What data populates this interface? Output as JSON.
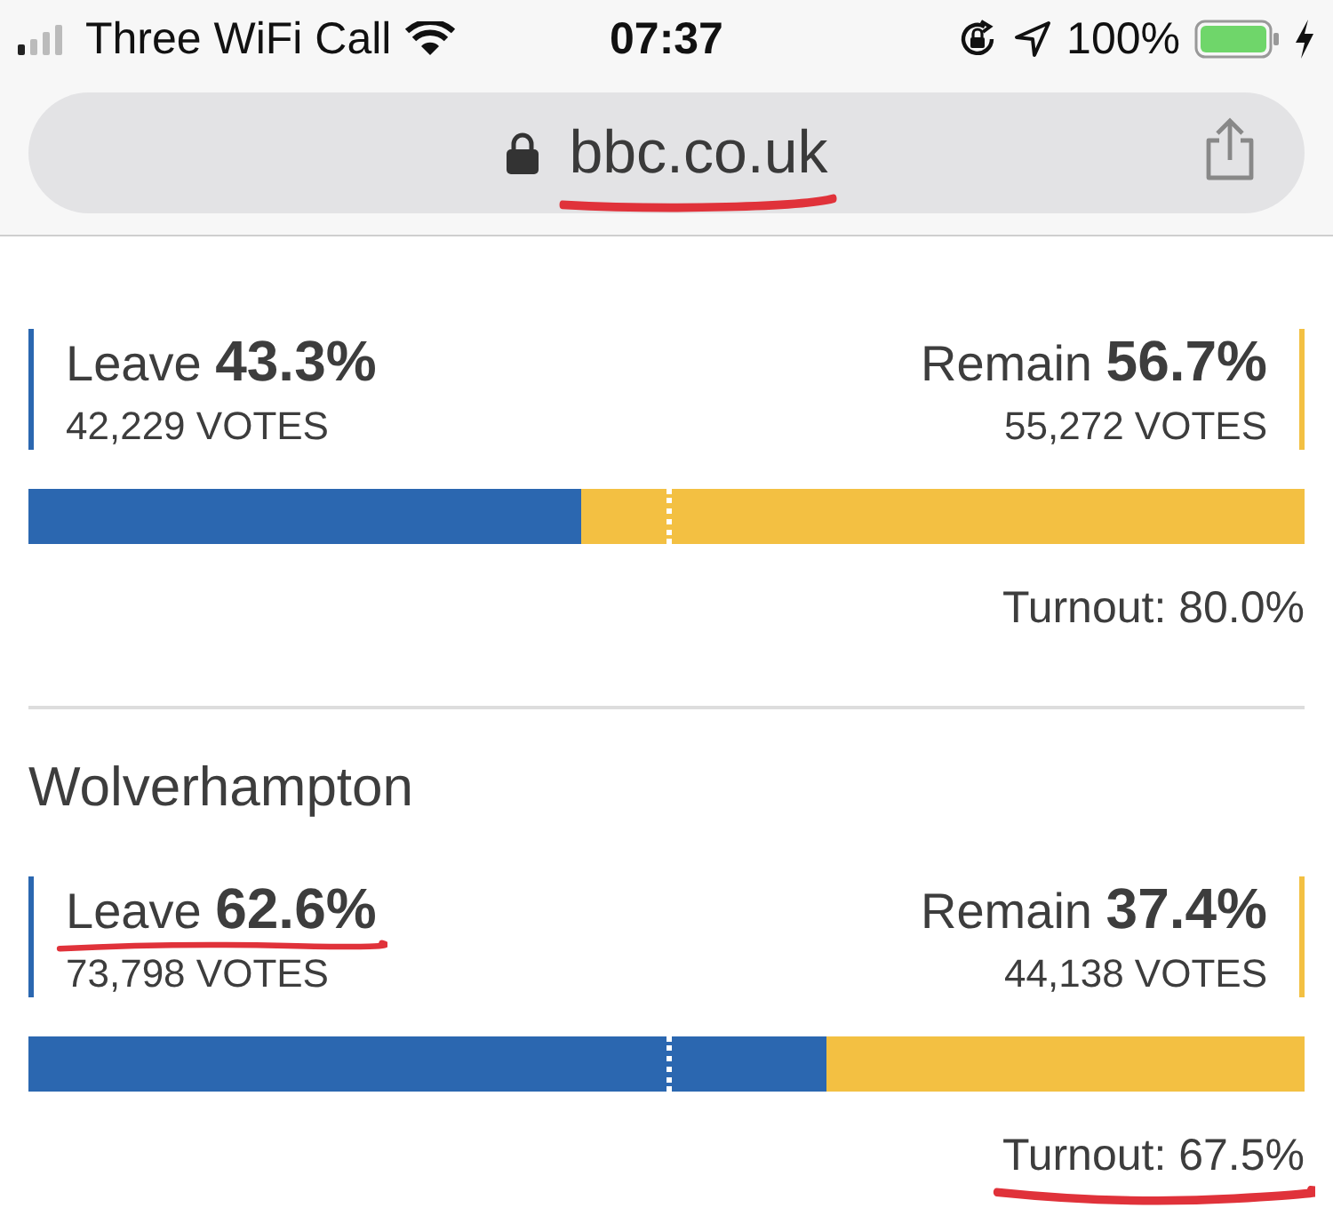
{
  "status_bar": {
    "carrier": "Three WiFi Call",
    "time": "07:37",
    "battery": "100%"
  },
  "address_bar": {
    "url": "bbc.co.uk",
    "url_underlined": true
  },
  "results": [
    {
      "leave": {
        "label": "Leave",
        "percent": "43.3%",
        "votes": "42,229 VOTES"
      },
      "remain": {
        "label": "Remain",
        "percent": "56.7%",
        "votes": "55,272 VOTES"
      },
      "level": 0.433,
      "turnout": "Turnout: 80.0%"
    },
    {
      "area": "Wolverhampton",
      "leave": {
        "label": "Leave",
        "percent": "62.6%",
        "votes": "73,798 VOTES",
        "underlined": true
      },
      "remain": {
        "label": "Remain",
        "percent": "37.4%",
        "votes": "44,138 VOTES"
      },
      "level": 0.626,
      "turnout": "Turnout: 67.5%",
      "turnout_underlined": true
    }
  ]
}
